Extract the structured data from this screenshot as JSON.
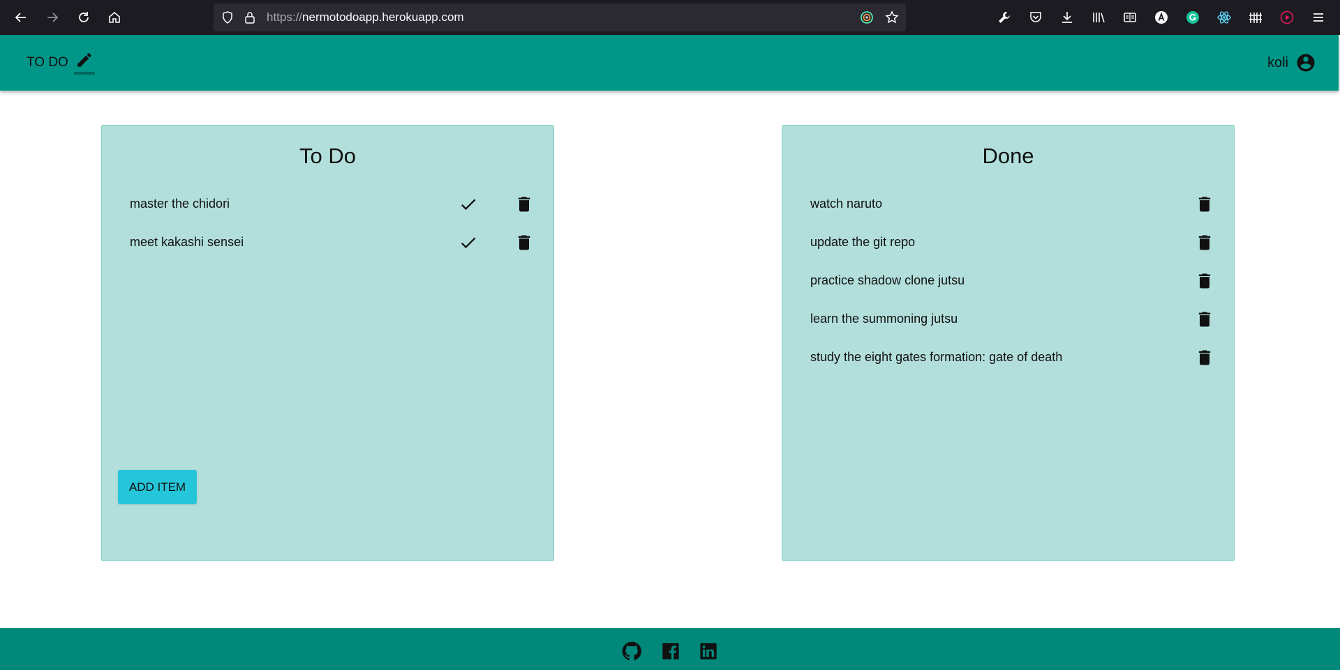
{
  "browser": {
    "url_scheme": "https://",
    "url_host": "nermotodoapp.herokuapp.com"
  },
  "header": {
    "brand": "TO DO",
    "username": "koli"
  },
  "todo": {
    "title": "To Do",
    "items": [
      {
        "label": "master the chidori"
      },
      {
        "label": "meet kakashi sensei"
      }
    ],
    "add_label": "ADD ITEM"
  },
  "done": {
    "title": "Done",
    "items": [
      {
        "label": "watch naruto"
      },
      {
        "label": "update the git repo"
      },
      {
        "label": "practice shadow clone jutsu"
      },
      {
        "label": "learn the summoning jutsu"
      },
      {
        "label": "study the eight gates formation: gate of death"
      }
    ]
  },
  "footer": {
    "links": [
      "github-icon",
      "facebook-icon",
      "linkedin-icon"
    ]
  },
  "colors": {
    "header": "#009688",
    "panel": "#b2dfdb",
    "button": "#26c6da",
    "footer": "#00897b"
  }
}
